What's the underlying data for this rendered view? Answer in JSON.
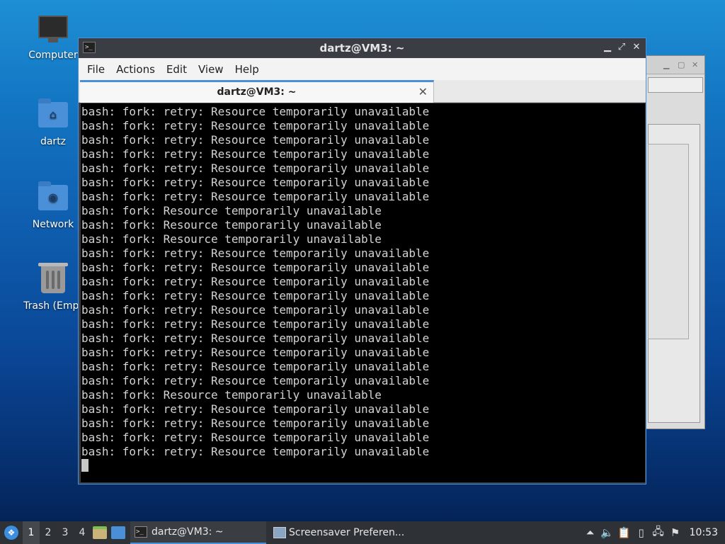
{
  "desktop": {
    "icons": [
      {
        "label": "Computer",
        "icon": "computer-icon"
      },
      {
        "label": "dartz",
        "icon": "home-folder-icon"
      },
      {
        "label": "Network",
        "icon": "network-folder-icon"
      },
      {
        "label": "Trash (Empt",
        "icon": "trash-icon"
      }
    ]
  },
  "terminal": {
    "title": "dartz@VM3: ~",
    "menu": [
      "File",
      "Actions",
      "Edit",
      "View",
      "Help"
    ],
    "tab_label": "dartz@VM3: ~",
    "lines": [
      "bash: fork: retry: Resource temporarily unavailable",
      "bash: fork: retry: Resource temporarily unavailable",
      "bash: fork: retry: Resource temporarily unavailable",
      "bash: fork: retry: Resource temporarily unavailable",
      "bash: fork: retry: Resource temporarily unavailable",
      "bash: fork: retry: Resource temporarily unavailable",
      "bash: fork: retry: Resource temporarily unavailable",
      "bash: fork: Resource temporarily unavailable",
      "bash: fork: Resource temporarily unavailable",
      "bash: fork: Resource temporarily unavailable",
      "bash: fork: retry: Resource temporarily unavailable",
      "bash: fork: retry: Resource temporarily unavailable",
      "bash: fork: retry: Resource temporarily unavailable",
      "bash: fork: retry: Resource temporarily unavailable",
      "bash: fork: retry: Resource temporarily unavailable",
      "bash: fork: retry: Resource temporarily unavailable",
      "bash: fork: retry: Resource temporarily unavailable",
      "bash: fork: retry: Resource temporarily unavailable",
      "bash: fork: retry: Resource temporarily unavailable",
      "bash: fork: retry: Resource temporarily unavailable",
      "bash: fork: Resource temporarily unavailable",
      "bash: fork: retry: Resource temporarily unavailable",
      "bash: fork: retry: Resource temporarily unavailable",
      "bash: fork: retry: Resource temporarily unavailable",
      "bash: fork: retry: Resource temporarily unavailable"
    ]
  },
  "taskbar": {
    "workspaces": [
      "1",
      "2",
      "3",
      "4"
    ],
    "active_workspace": "1",
    "tasks": [
      {
        "label": "dartz@VM3: ~",
        "active": true
      },
      {
        "label": "Screensaver Preferen...",
        "active": false
      }
    ],
    "clock": "10:53"
  },
  "colors": {
    "accent": "#4a90d9",
    "terminal_bg": "#000000",
    "terminal_fg": "#d3d3d3",
    "taskbar_bg": "#2e3236"
  }
}
